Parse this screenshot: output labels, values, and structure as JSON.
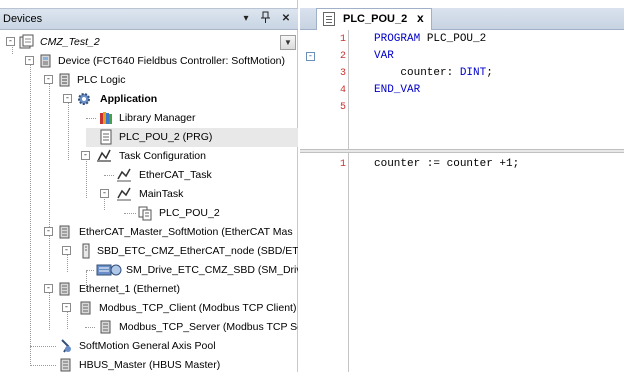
{
  "devices_panel": {
    "title": "Devices",
    "buttons": {
      "dropdown": "▾",
      "pin": "ꟷ",
      "close": "✕"
    },
    "tree": [
      {
        "label": "CMZ_Test_2",
        "icon": "project-icon"
      },
      {
        "label": "Device (FCT640 Fieldbus Controller: SoftMotion)",
        "icon": "device-icon"
      },
      {
        "label": "PLC Logic",
        "icon": "plc-logic-icon"
      },
      {
        "label": "Application",
        "icon": "application-gear-icon"
      },
      {
        "label": "Library Manager",
        "icon": "library-books-icon"
      },
      {
        "label": "PLC_POU_2 (PRG)",
        "icon": "pou-document-icon"
      },
      {
        "label": "Task Configuration",
        "icon": "task-config-icon"
      },
      {
        "label": "EtherCAT_Task",
        "icon": "task-icon"
      },
      {
        "label": "MainTask",
        "icon": "task-icon"
      },
      {
        "label": "PLC_POU_2",
        "icon": "program-call-icon"
      },
      {
        "label": "EtherCAT_Master_SoftMotion (EtherCAT Mas",
        "icon": "fieldbus-device-icon"
      },
      {
        "label": "SBD_ETC_CMZ_EtherCAT_node (SBD/ET(",
        "icon": "node-device-icon"
      },
      {
        "label": "SM_Drive_ETC_CMZ_SBD (SM_Driv",
        "icon": "drive-icon"
      },
      {
        "label": "Ethernet_1 (Ethernet)",
        "icon": "fieldbus-device-icon"
      },
      {
        "label": "Modbus_TCP_Client (Modbus TCP Client)",
        "icon": "fieldbus-device-icon"
      },
      {
        "label": "Modbus_TCP_Server (Modbus TCP S(",
        "icon": "fieldbus-device-icon"
      },
      {
        "label": "SoftMotion General Axis Pool",
        "icon": "axis-pool-icon"
      },
      {
        "label": "HBUS_Master (HBUS Master)",
        "icon": "fieldbus-device-icon"
      }
    ]
  },
  "editor": {
    "tab_label": "PLC_POU_2",
    "tab_close": "x",
    "declaration": {
      "lines": [
        {
          "num": "1",
          "keyword": "PROGRAM",
          "rest": " PLC_POU_2"
        },
        {
          "num": "2",
          "keyword": "VAR",
          "rest": ""
        },
        {
          "num": "3",
          "pre": "    counter: ",
          "keyword": "DINT",
          "rest": ";"
        },
        {
          "num": "4",
          "keyword": "END_VAR",
          "rest": ""
        },
        {
          "num": "5",
          "keyword": "",
          "rest": ""
        }
      ]
    },
    "implementation": {
      "lines": [
        {
          "num": "1",
          "text": "counter := counter +1;"
        }
      ]
    }
  }
}
